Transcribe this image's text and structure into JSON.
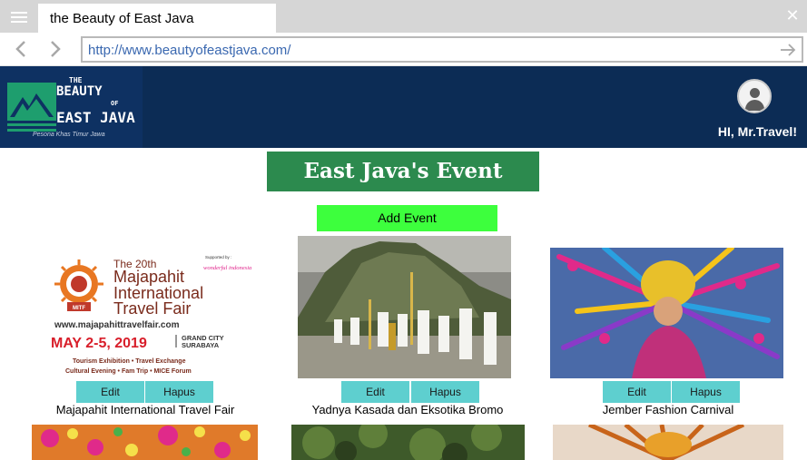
{
  "browser": {
    "tab_title": "the Beauty of East Java",
    "url": "http://www.beautyofeastjava.com/"
  },
  "header": {
    "logo": {
      "line1": "THE",
      "line2": "BEAUTY",
      "line3": "OF",
      "line4": "EAST JAVA",
      "tagline": "Pesona Khas Timur Jawa"
    },
    "greeting": "HI, Mr.Travel!"
  },
  "main": {
    "title": "East Java's Event",
    "add_label": "Add Event",
    "edit_label": "Edit",
    "delete_label": "Hapus",
    "events": [
      {
        "name": "Majapahit International Travel Fair",
        "poster": {
          "edition": "The 20th",
          "supported_by": "Supported by :",
          "brand": "wonderful indonesia",
          "title1": "Majapahit",
          "title2": "International",
          "title3": "Travel Fair",
          "website": "www.majapahittravelfair.com",
          "date": "MAY 2-5, 2019",
          "venue1": "GRAND CITY",
          "venue2": "SURABAYA",
          "activities1": "Tourism Exhibition • Travel Exchange",
          "activities2": "Cultural Evening • Fam Trip • MICE Forum",
          "logo_text": "MITF"
        }
      },
      {
        "name": "Yadnya Kasada dan Eksotika Bromo"
      },
      {
        "name": "Jember Fashion Carnival"
      }
    ]
  },
  "colors": {
    "header_bg": "#0c2c55",
    "title_bg": "#2c8a4e",
    "add_button": "#3dff3d",
    "small_buttons": "#5ecfcf",
    "url_text": "#3a68b0"
  },
  "icons": [
    "menu-icon",
    "close-icon",
    "back-arrow-icon",
    "forward-arrow-icon",
    "go-arrow-icon",
    "user-avatar-icon"
  ]
}
